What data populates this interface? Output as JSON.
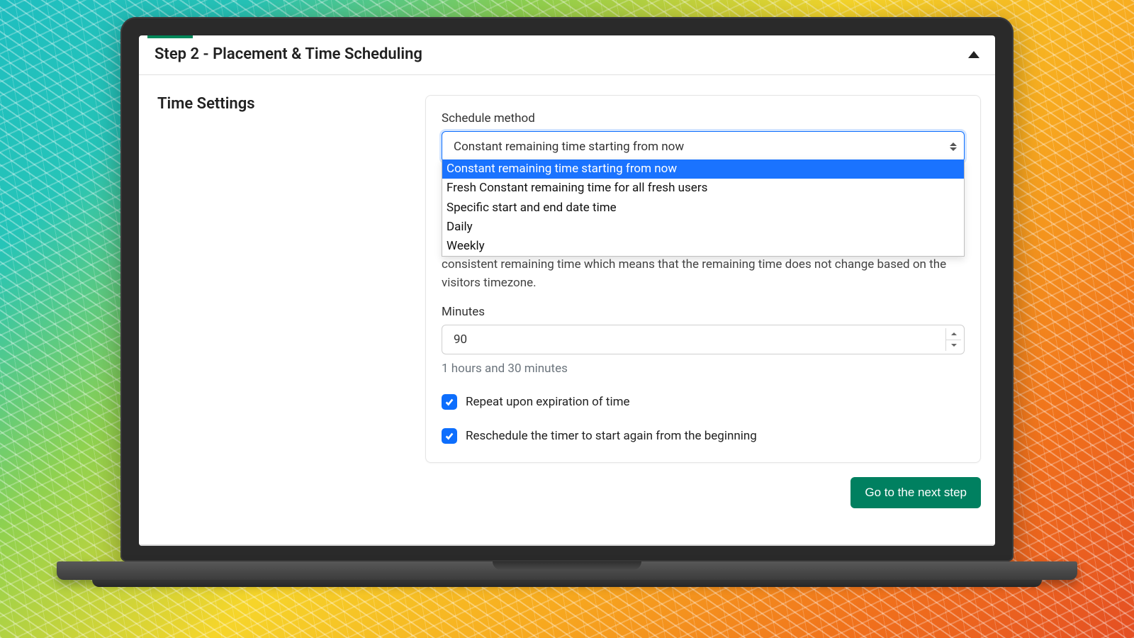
{
  "header": {
    "title": "Step 2 - Placement & Time Scheduling"
  },
  "section": {
    "title": "Time Settings"
  },
  "schedule": {
    "label": "Schedule method",
    "selected": "Constant remaining time starting from now",
    "options": [
      "Constant remaining time starting from now",
      "Fresh Constant remaining time for all fresh users",
      "Specific start and end date time",
      "Daily",
      "Weekly"
    ],
    "description": "consistent remaining time which means that the remaining time does not change based on the visitors timezone."
  },
  "minutes": {
    "label": "Minutes",
    "value": "90",
    "hint": "1 hours and 30 minutes"
  },
  "repeat": {
    "checked": true,
    "label": "Repeat upon expiration of time"
  },
  "reschedule": {
    "checked": true,
    "label": "Reschedule the timer to start again from the beginning"
  },
  "footer": {
    "next_label": "Go to the next step"
  }
}
